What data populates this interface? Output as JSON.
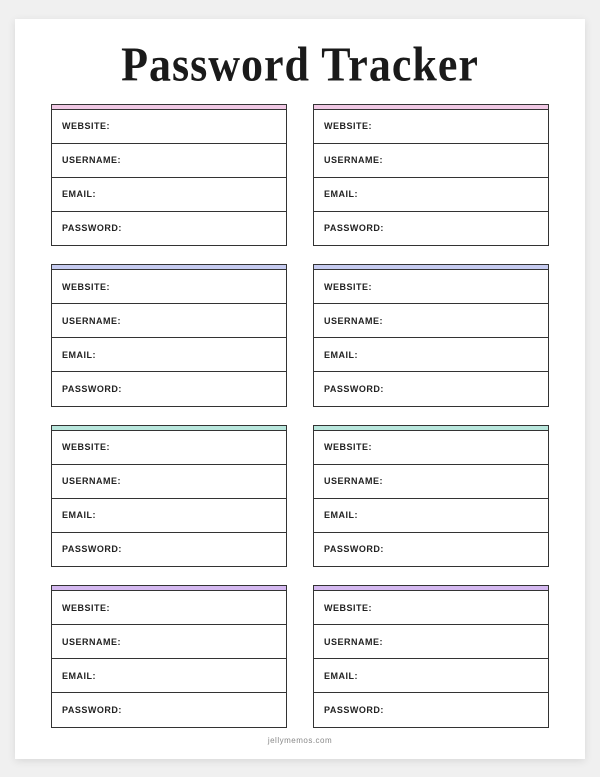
{
  "title": "Password Tracker",
  "footer": "jellymemos.com",
  "fields": {
    "website": "WEBSITE:",
    "username": "USERNAME:",
    "email": "EMAIL:",
    "password": "PASSWORD:"
  },
  "accents": {
    "row1": "#f0c8e4",
    "row2": "#c6cbf0",
    "row3": "#b8e6dc",
    "row4": "#d4b8f0"
  },
  "cards": [
    {
      "accent": "row1"
    },
    {
      "accent": "row1"
    },
    {
      "accent": "row2"
    },
    {
      "accent": "row2"
    },
    {
      "accent": "row3"
    },
    {
      "accent": "row3"
    },
    {
      "accent": "row4"
    },
    {
      "accent": "row4"
    }
  ]
}
